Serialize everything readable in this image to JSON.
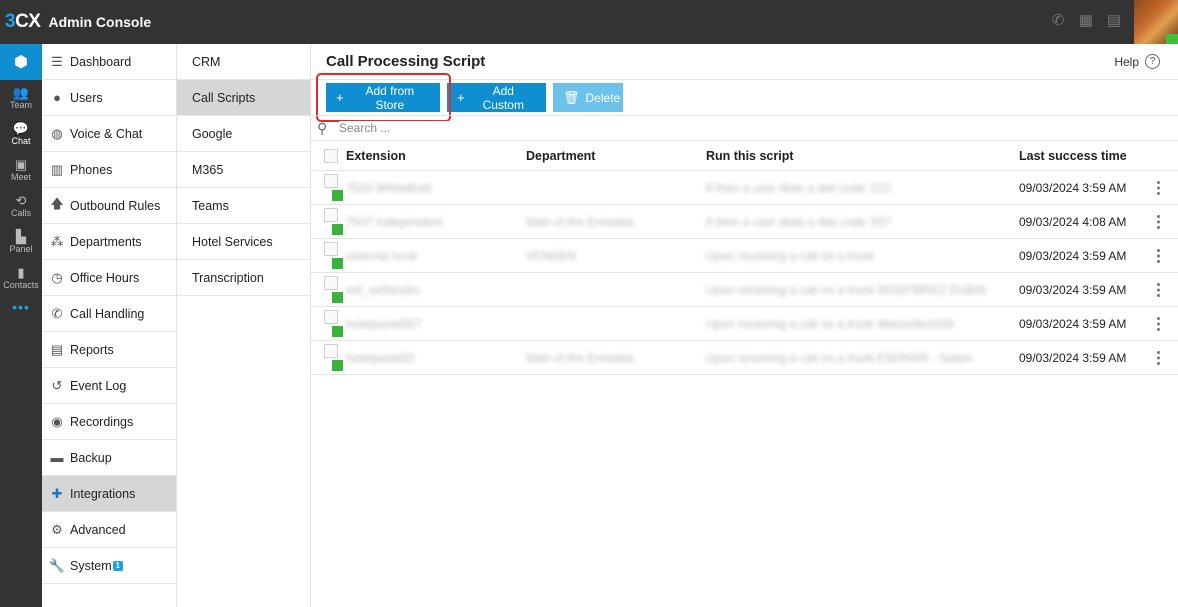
{
  "app": {
    "logo_three": "3",
    "logo_cx": "CX",
    "title": "Admin Console"
  },
  "rail": {
    "items": [
      {
        "label": "Team",
        "icon": "team-icon"
      },
      {
        "label": "Chat",
        "icon": "chat-icon"
      },
      {
        "label": "Meet",
        "icon": "meet-icon"
      },
      {
        "label": "Calls",
        "icon": "calls-icon"
      },
      {
        "label": "Panel",
        "icon": "panel-icon"
      },
      {
        "label": "Contacts",
        "icon": "contacts-icon"
      }
    ],
    "more": "•••"
  },
  "mainnav": {
    "items": [
      {
        "label": "Dashboard"
      },
      {
        "label": "Users"
      },
      {
        "label": "Voice & Chat"
      },
      {
        "label": "Phones"
      },
      {
        "label": "Outbound Rules"
      },
      {
        "label": "Departments"
      },
      {
        "label": "Office Hours"
      },
      {
        "label": "Call Handling"
      },
      {
        "label": "Reports"
      },
      {
        "label": "Event Log"
      },
      {
        "label": "Recordings"
      },
      {
        "label": "Backup"
      },
      {
        "label": "Integrations"
      },
      {
        "label": "Advanced"
      },
      {
        "label": "System",
        "badge": "1"
      }
    ]
  },
  "subnav": {
    "items": [
      {
        "label": "CRM"
      },
      {
        "label": "Call Scripts"
      },
      {
        "label": "Google"
      },
      {
        "label": "M365"
      },
      {
        "label": "Teams"
      },
      {
        "label": "Hotel Services"
      },
      {
        "label": "Transcription"
      }
    ]
  },
  "content": {
    "title": "Call Processing Script",
    "help": "Help",
    "help_q": "?",
    "toolbar": {
      "add_store": "Add from Store",
      "add_custom": "Add Custom",
      "delete": "Delete"
    },
    "search_placeholder": "Search ...",
    "columns": [
      "Extension",
      "Department",
      "Run this script",
      "Last success time"
    ],
    "rows": [
      {
        "extension": "7510 WhiteBold",
        "department": "",
        "script": "If then a user dials a dial code '212",
        "time": "09/03/2024 3:59 AM"
      },
      {
        "extension": "7507 Independent",
        "department": "Web of the Emirates",
        "script": "If then a user dials a dial code '207",
        "time": "09/03/2024 4:08 AM"
      },
      {
        "extension": "external ivrstl",
        "department": "VENDEN",
        "script": "Upon receiving a call on a trunk",
        "time": "09/03/2024 3:59 AM"
      },
      {
        "extension": "ext_selfstudio",
        "department": "",
        "script": "Upon receiving a call on a trunk 9032FIBRE2 DUBAI",
        "time": "09/03/2024 3:59 AM"
      },
      {
        "extension": "hotelpanel057",
        "department": "",
        "script": "Upon receiving a call on a trunk Wenzelbut100",
        "time": "09/03/2024 3:59 AM"
      },
      {
        "extension": "hotelpanel02",
        "department": "Web of the Emirates",
        "script": "Upon receiving a call on a trunk ESOHAR - Salam",
        "time": "09/03/2024 3:59 AM"
      }
    ]
  },
  "colors": {
    "accent": "#0f8fd1",
    "topbar": "#333333",
    "status_ok": "#3bb33b",
    "highlight": "#e5262b"
  }
}
